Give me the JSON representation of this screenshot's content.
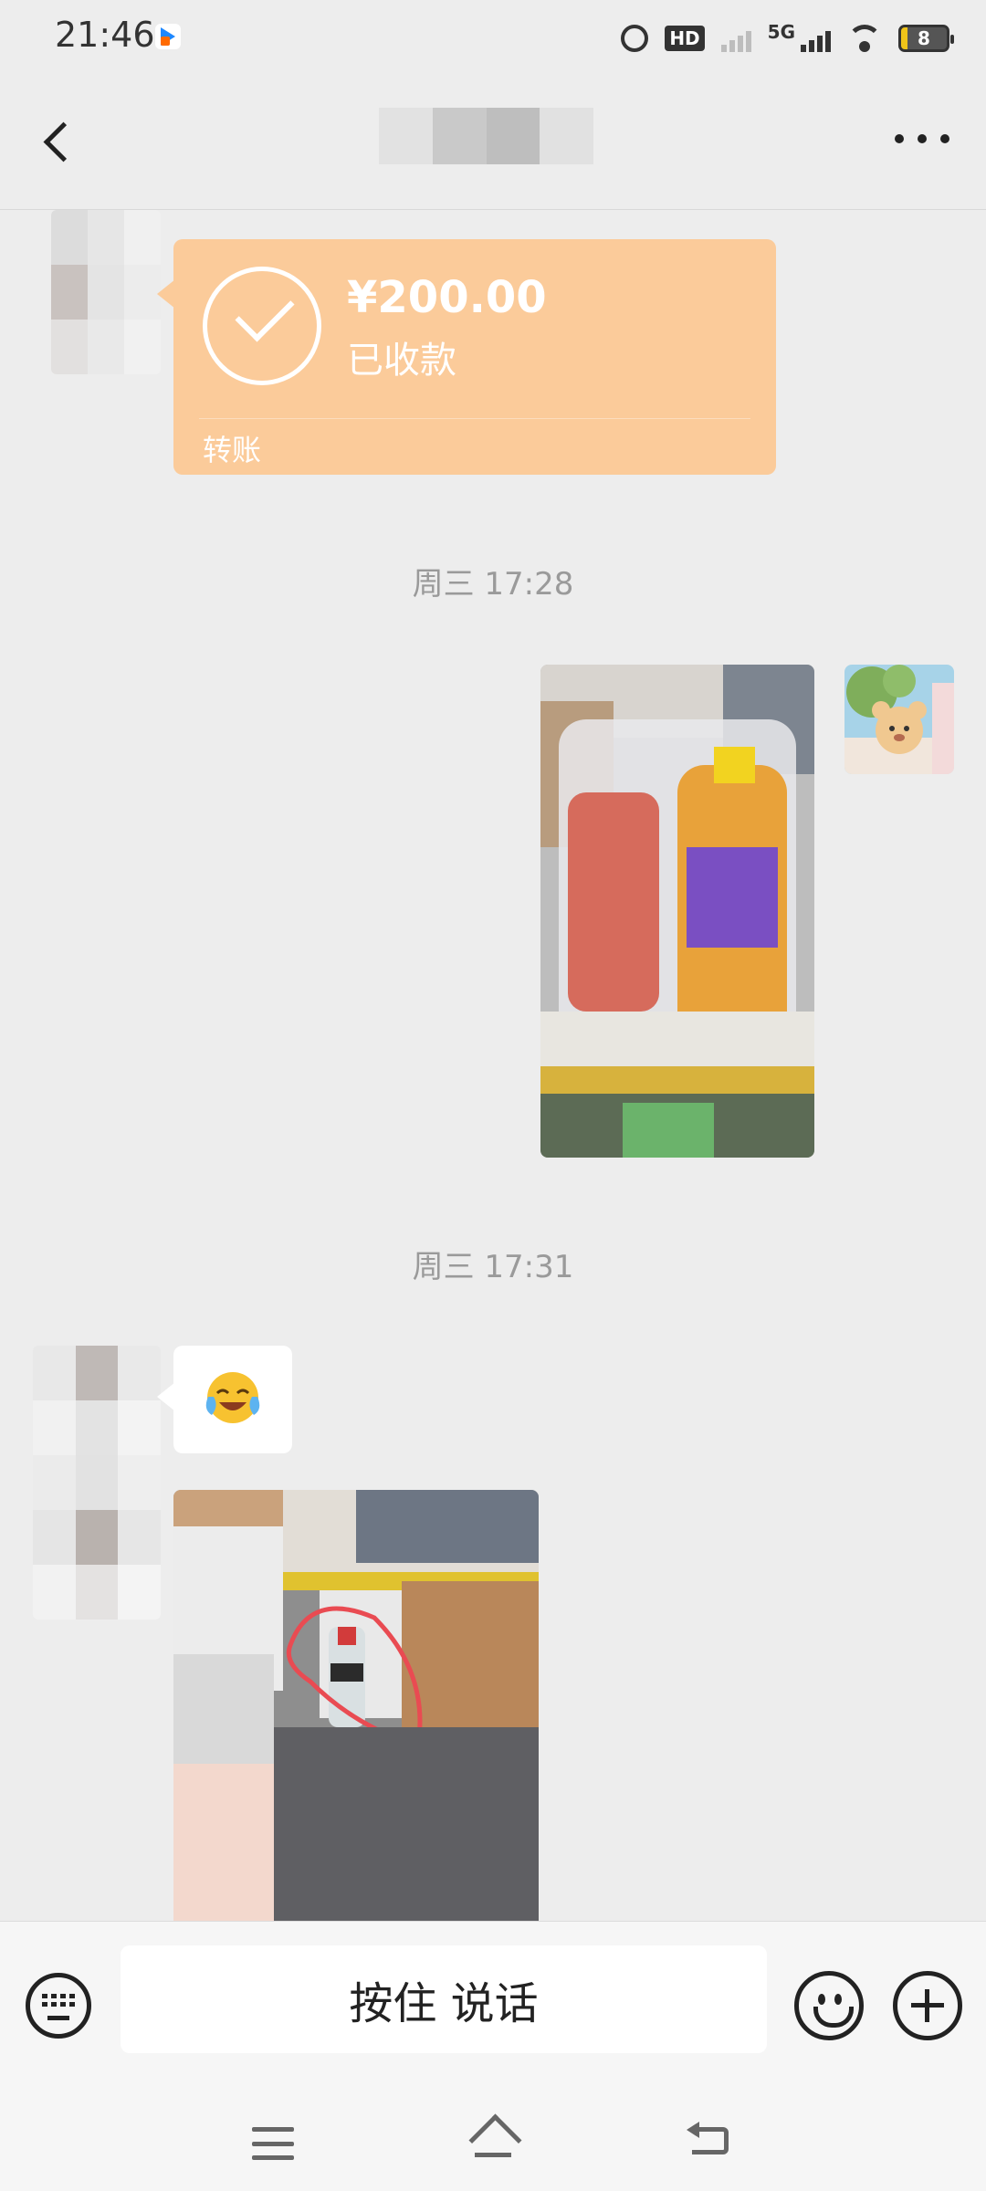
{
  "status_bar": {
    "time": "21:46",
    "network": "5G",
    "battery_level": "8",
    "hd_label": "HD",
    "icons": [
      "app-icon",
      "alarm-icon",
      "hd-icon",
      "signal-icon",
      "wifi-icon",
      "battery-icon"
    ]
  },
  "header": {
    "contact_name": "",
    "icons": [
      "back-icon",
      "more-icon"
    ]
  },
  "messages": [
    {
      "type": "transfer",
      "direction": "received",
      "amount": "¥200.00",
      "status": "已收款",
      "label": "转账",
      "accent_color": "#fbcb9a"
    },
    {
      "type": "timestamp",
      "text": "周三 17:28"
    },
    {
      "type": "image",
      "direction": "sent",
      "content": "photo"
    },
    {
      "type": "timestamp",
      "text": "周三 17:31"
    },
    {
      "type": "emoji",
      "direction": "received",
      "icon": "laughing-crying-emoji-icon"
    },
    {
      "type": "image",
      "direction": "received",
      "content": "photo"
    }
  ],
  "input_bar": {
    "hold_to_talk_label": "按住 说话",
    "icons": [
      "keyboard-icon",
      "emoji-icon",
      "plus-icon"
    ]
  },
  "nav_bar": {
    "icons": [
      "menu-icon",
      "home-icon",
      "back-icon"
    ]
  },
  "colors": {
    "background": "#ededed",
    "transfer_bubble": "#fbcb9a",
    "timestamp_text": "#9a9a9a",
    "input_bar_bg": "#f6f6f6"
  }
}
